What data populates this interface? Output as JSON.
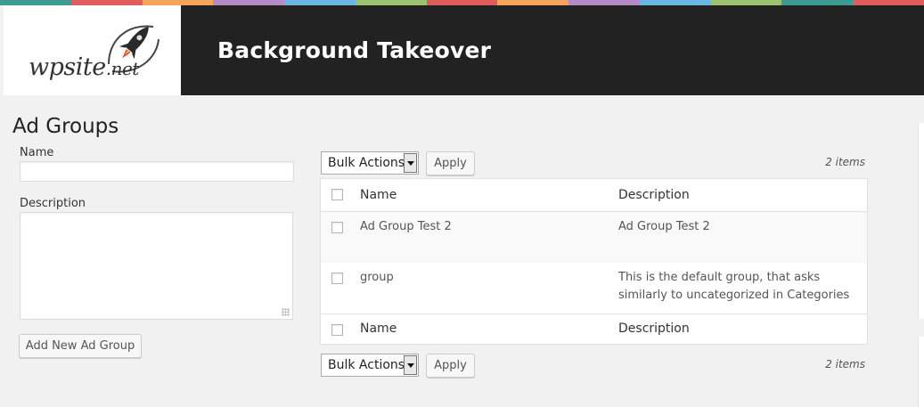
{
  "header": {
    "logo_text": "wpsite",
    "logo_suffix": ".net",
    "title": "Background Takeover"
  },
  "stripe_colors": [
    "#3d9c91",
    "#e05d5d",
    "#f4a55b",
    "#b58ac6",
    "#6bb7e4",
    "#9dc170",
    "#e05d5d",
    "#f4a55b",
    "#b58ac6",
    "#6bb7e4",
    "#9dc170",
    "#3d9c91",
    "#e05d5d"
  ],
  "page": {
    "title": "Ad Groups"
  },
  "form": {
    "name_label": "Name",
    "name_value": "",
    "description_label": "Description",
    "description_value": "",
    "add_button": "Add New Ad Group"
  },
  "bulk_top": {
    "select_value": "Bulk Actions",
    "apply_label": "Apply",
    "count": "2 items"
  },
  "bulk_bottom": {
    "select_value": "Bulk Actions",
    "apply_label": "Apply",
    "count": "2 items"
  },
  "table": {
    "columns": [
      "Name",
      "Description"
    ],
    "rows": [
      {
        "name": "Ad Group Test 2",
        "description": "Ad Group Test 2"
      },
      {
        "name": "group",
        "description": "This is the default group, that asks similarly to uncategorized in Categories"
      }
    ]
  },
  "icons": {
    "logo": "rocket-icon",
    "select_arrow": "chevron-down-icon",
    "resize": "resize-grip-icon"
  }
}
